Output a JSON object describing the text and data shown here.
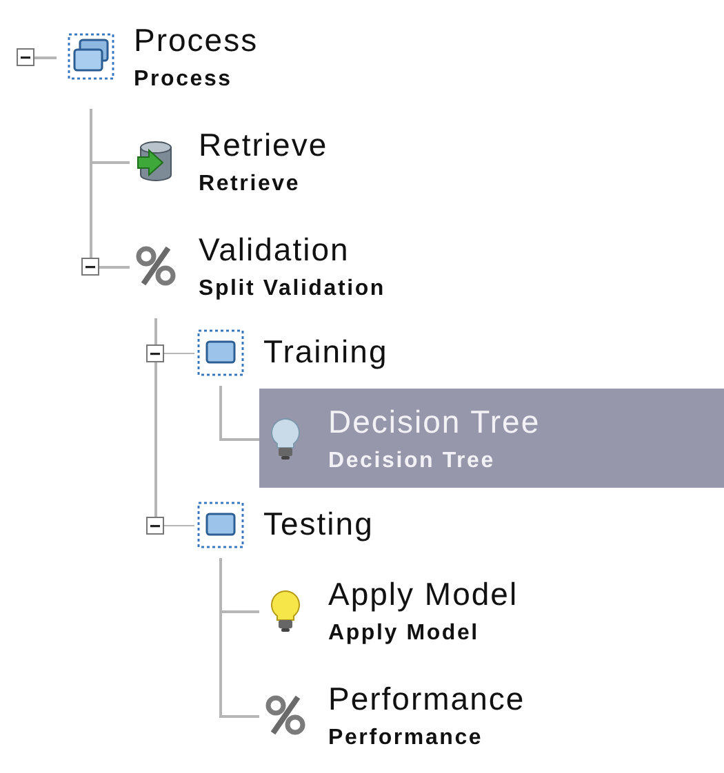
{
  "tree": {
    "title": "Process",
    "subtitle": "Process",
    "kind": "process",
    "expanded": true,
    "selected": false,
    "children": [
      {
        "title": "Retrieve",
        "subtitle": "Retrieve",
        "kind": "database",
        "selected": false
      },
      {
        "title": "Validation",
        "subtitle": "Split Validation",
        "kind": "percent",
        "expanded": true,
        "selected": false,
        "children": [
          {
            "title": "Training",
            "kind": "subprocess",
            "expanded": true,
            "selected": false,
            "children": [
              {
                "title": "Decision Tree",
                "subtitle": "Decision Tree",
                "kind": "bulb",
                "selected": true
              }
            ]
          },
          {
            "title": "Testing",
            "kind": "subprocess",
            "expanded": true,
            "selected": false,
            "children": [
              {
                "title": "Apply Model",
                "subtitle": "Apply Model",
                "kind": "bulb",
                "selected": false
              },
              {
                "title": "Performance",
                "subtitle": "Performance",
                "kind": "percent",
                "selected": false
              }
            ]
          }
        ]
      }
    ]
  }
}
